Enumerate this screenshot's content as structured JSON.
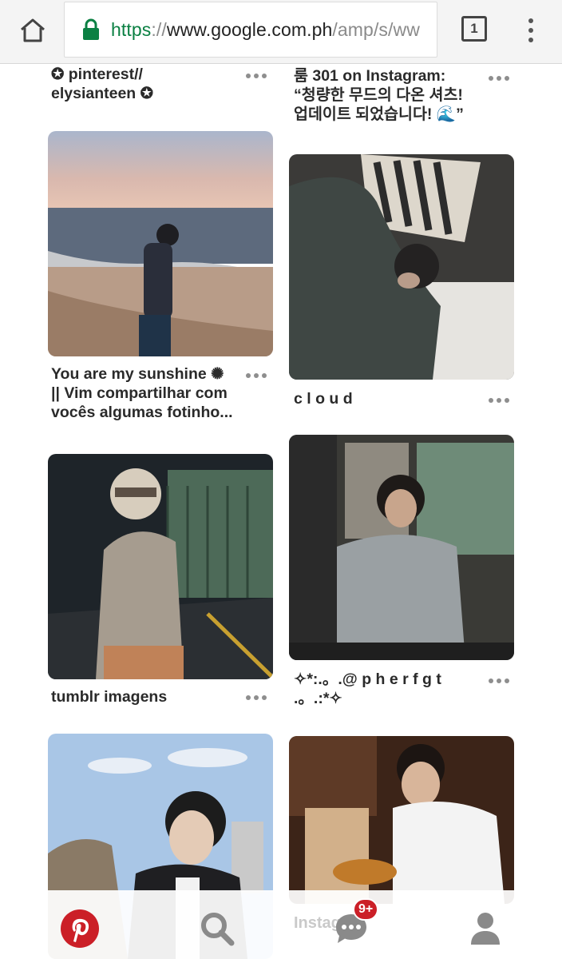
{
  "browser": {
    "url": {
      "scheme": "https",
      "separator": "://",
      "host": "www.google.com.ph",
      "path": "/amp/s/ww"
    },
    "tab_count": "1",
    "lock_color": "#0b8043"
  },
  "feed": {
    "pins": [
      {
        "title_line1": "✪ pinterest//",
        "title_line2": "elysianteen ✪"
      },
      {
        "title_line1": "룸 301 on Instagram:",
        "title_line2": "“청량한 무드의 다온 셔츠!",
        "title_line3": "업데이트 되었습니다! 🌊”"
      },
      {
        "title_line1": "You are my sunshine ✺",
        "title_line2": "|| Vim compartilhar com",
        "title_line3": "vocês algumas fotinho..."
      },
      {
        "title_line1": "c l o u d"
      },
      {
        "title_line1": "tumblr imagens"
      },
      {
        "title_line1": "✧*:.。.@ p h e r f g t",
        "title_line2": ".。.:*✧"
      },
      {
        "title_line1": ""
      },
      {
        "title_line1": "Instag"
      }
    ]
  },
  "bottom_nav": {
    "notifications_badge": "9+",
    "brand_color": "#cb1f27",
    "icons": [
      "pinterest-logo-icon",
      "search-icon",
      "messages-icon",
      "profile-icon"
    ]
  }
}
